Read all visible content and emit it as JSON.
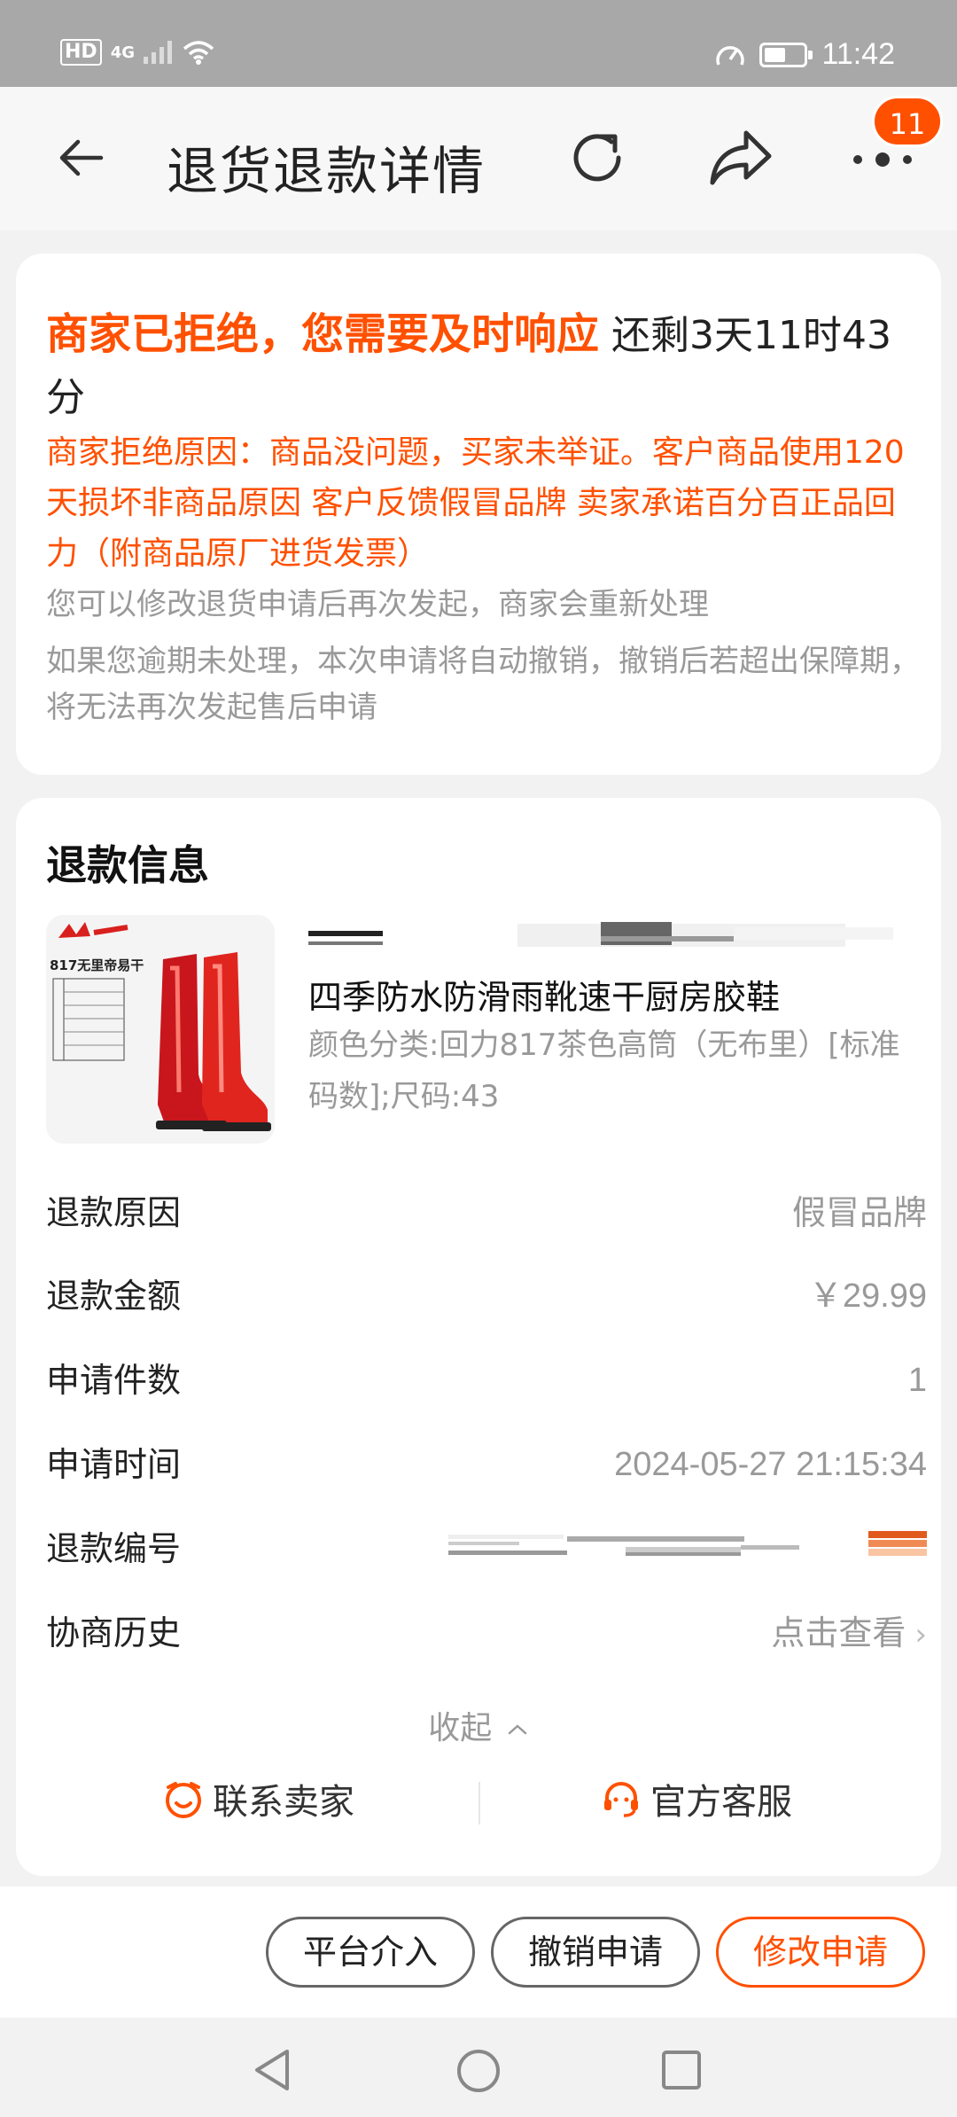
{
  "status_bar": {
    "hd": "HD",
    "network": "4G",
    "time": "11:42",
    "battery_level": 0.55
  },
  "header": {
    "title": "退货退款详情",
    "badge_count": "11"
  },
  "status_card": {
    "headline": "商家已拒绝，您需要及时响应",
    "remaining": "还剩3天11时43分",
    "reject_reason": "商家拒绝原因：商品没问题，买家未举证。客户商品使用120天损坏非商品原因 客户反馈假冒品牌 卖家承诺百分百正品回力（附商品原厂进货发票）",
    "hint_modify": "您可以修改退货申请后再次发起，商家会重新处理",
    "hint_overdue": "如果您逾期未处理，本次申请将自动撤销，撤销后若超出保障期，将无法再次发起售后申请"
  },
  "refund_info": {
    "section_title": "退款信息",
    "product": {
      "image_text": "817无里帝易干",
      "name": "四季防水防滑雨靴速干厨房胶鞋",
      "spec": "颜色分类:回力817茶色高筒（无布里）[标准码数];尺码:43"
    },
    "rows": [
      {
        "label": "退款原因",
        "value": "假冒品牌"
      },
      {
        "label": "退款金额",
        "value": "￥29.99"
      },
      {
        "label": "申请件数",
        "value": "1"
      },
      {
        "label": "申请时间",
        "value": "2024-05-27 21:15:34"
      },
      {
        "label": "退款编号",
        "value": ""
      },
      {
        "label": "协商历史",
        "value": "点击查看"
      }
    ],
    "collapse_label": "收起",
    "contact_seller": "联系卖家",
    "official_service": "官方客服"
  },
  "actions": {
    "platform": "平台介入",
    "cancel": "撤销申请",
    "modify": "修改申请"
  },
  "colors": {
    "accent": "#ff5000",
    "muted": "#999999"
  }
}
